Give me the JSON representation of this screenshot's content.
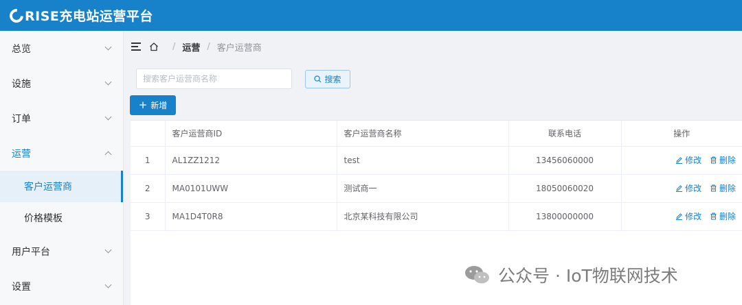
{
  "header": {
    "title": "RISE充电站运营平台",
    "bg_color": "#1781c9"
  },
  "sidebar": {
    "items": [
      {
        "label": "总览",
        "expanded": false
      },
      {
        "label": "设施",
        "expanded": false
      },
      {
        "label": "订单",
        "expanded": false
      },
      {
        "label": "运营",
        "expanded": true,
        "children": [
          {
            "label": "客户运营商",
            "selected": true
          },
          {
            "label": "价格模板",
            "selected": false
          }
        ]
      },
      {
        "label": "用户平台",
        "expanded": false
      },
      {
        "label": "设置",
        "expanded": false
      }
    ]
  },
  "breadcrumb": {
    "section": "运营",
    "current": "客户运营商"
  },
  "search": {
    "placeholder": "搜索客户运营商名称",
    "value": "",
    "button_label": "搜索"
  },
  "toolbar": {
    "add_label": "新增"
  },
  "table": {
    "columns": [
      "",
      "客户运营商ID",
      "客户运营商名称",
      "联系电话",
      "操作"
    ],
    "rows": [
      {
        "index": "1",
        "id": "AL1ZZ1212",
        "name": "test",
        "phone": "13456060000"
      },
      {
        "index": "2",
        "id": "MA0101UWW",
        "name": "测试商一",
        "phone": "18050060020"
      },
      {
        "index": "3",
        "id": "MA1D4T0R8",
        "name": "北京某科技有限公司",
        "phone": "13800000000"
      }
    ],
    "actions": {
      "edit": "修改",
      "delete": "删除"
    }
  },
  "watermark": {
    "text": "公众号 · IoT物联网技术",
    "icon": "wechat-icon"
  },
  "colors": {
    "accent": "#1781c9",
    "selected_bg": "#e6f0f9"
  }
}
